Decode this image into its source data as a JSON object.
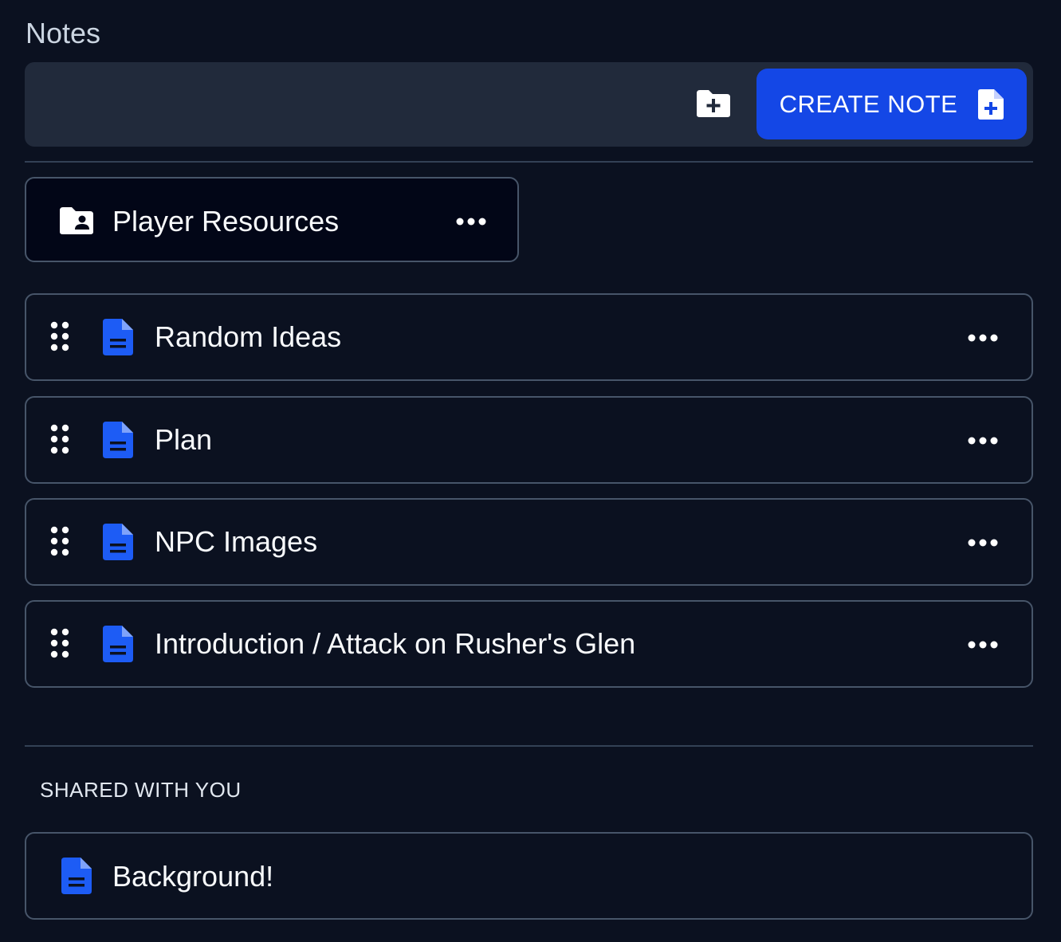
{
  "page": {
    "title": "Notes"
  },
  "toolbar": {
    "new_folder_icon": "folder-plus-icon",
    "create_note_label": "CREATE NOTE",
    "create_note_icon": "file-plus-icon",
    "accent_color": "#1447e6"
  },
  "folders": [
    {
      "label": "Player Resources",
      "icon": "folder-user-icon"
    }
  ],
  "notes": [
    {
      "label": "Random Ideas",
      "icon": "document-icon"
    },
    {
      "label": "Plan",
      "icon": "document-icon"
    },
    {
      "label": "NPC Images",
      "icon": "document-icon"
    },
    {
      "label": "Introduction / Attack on Rusher's Glen",
      "icon": "document-icon"
    }
  ],
  "shared": {
    "heading": "SHARED WITH YOU",
    "items": [
      {
        "label": "Background!",
        "icon": "document-icon"
      }
    ]
  },
  "colors": {
    "background": "#0b1120",
    "toolbar_bg": "#212a3b",
    "doc_icon": "#1d5cf5",
    "border": "#475569"
  }
}
